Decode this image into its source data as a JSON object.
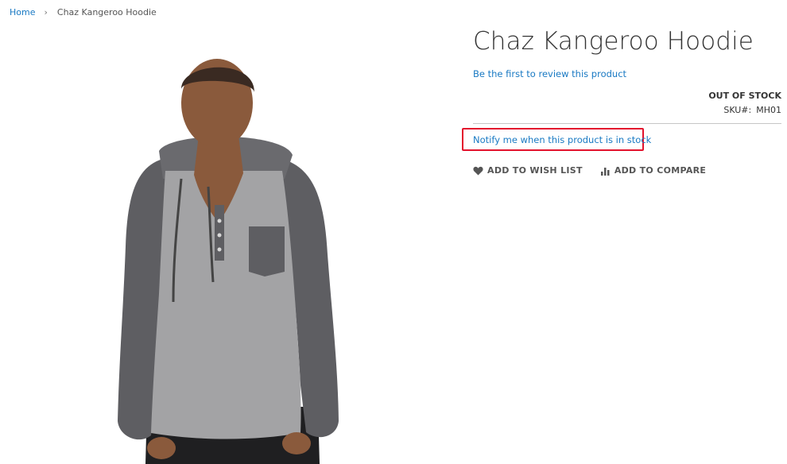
{
  "breadcrumb": {
    "home": "Home",
    "separator": "›",
    "current": "Chaz Kangeroo Hoodie"
  },
  "product": {
    "title": "Chaz Kangeroo Hoodie",
    "review_link": "Be the first to review this product",
    "stock_status": "OUT OF STOCK",
    "sku_label": "SKU#:",
    "sku_value": "MH01",
    "notify_link": "Notify me when this product is in stock"
  },
  "actions": {
    "wishlist": {
      "label": "ADD TO WISH LIST",
      "icon": "heart-icon"
    },
    "compare": {
      "label": "ADD TO COMPARE",
      "icon": "bar-chart-icon"
    }
  },
  "image": {
    "alt": "Chaz Kangeroo Hoodie",
    "colors": {
      "body": "#a3a3a5",
      "sleeves": "#5e5e62",
      "skin": "#8a5a3c",
      "pants": "#1f1f21"
    }
  },
  "colors": {
    "link": "#1979c3",
    "highlight_border": "#e3122d",
    "text": "#333333"
  }
}
